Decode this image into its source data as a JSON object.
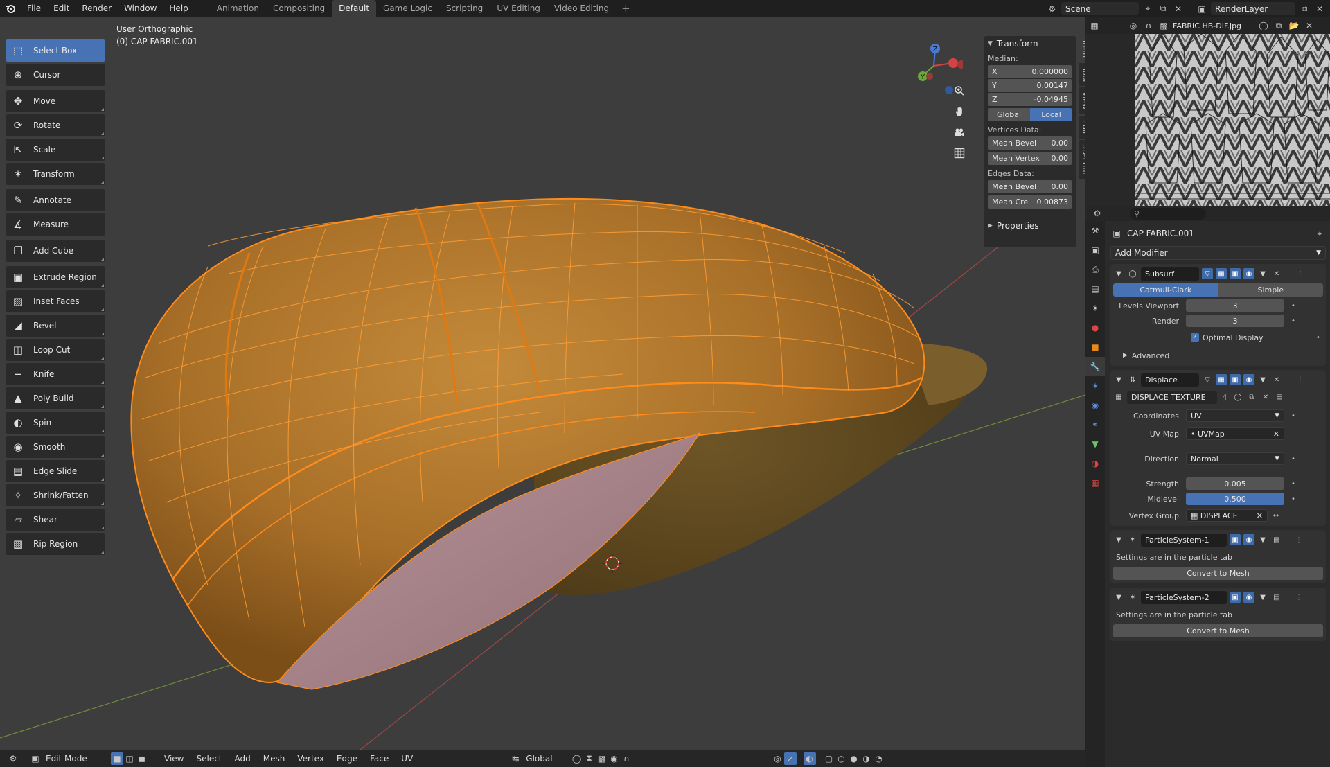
{
  "topbar": {
    "menus": [
      "File",
      "Edit",
      "Render",
      "Window",
      "Help"
    ],
    "workspaces": [
      "Animation",
      "Compositing",
      "Default",
      "Game Logic",
      "Scripting",
      "UV Editing",
      "Video Editing"
    ],
    "active_workspace": "Default",
    "plus": "+",
    "scene": "Scene",
    "render_layer": "RenderLayer"
  },
  "viewport": {
    "view_name": "User Orthographic",
    "object_name": "(0) CAP FABRIC.001"
  },
  "toolbar": {
    "tools": [
      {
        "label": "Select Box",
        "icon": "select-box-icon",
        "active": true
      },
      {
        "label": "Cursor",
        "icon": "cursor-icon"
      },
      {
        "label": "Move",
        "icon": "move-icon"
      },
      {
        "label": "Rotate",
        "icon": "rotate-icon"
      },
      {
        "label": "Scale",
        "icon": "scale-icon"
      },
      {
        "label": "Transform",
        "icon": "transform-icon"
      },
      {
        "label": "Annotate",
        "icon": "annotate-icon"
      },
      {
        "label": "Measure",
        "icon": "measure-icon"
      },
      {
        "label": "Add Cube",
        "icon": "add-cube-icon"
      },
      {
        "label": "Extrude Region",
        "icon": "extrude-icon"
      },
      {
        "label": "Inset Faces",
        "icon": "inset-icon"
      },
      {
        "label": "Bevel",
        "icon": "bevel-icon"
      },
      {
        "label": "Loop Cut",
        "icon": "loop-cut-icon"
      },
      {
        "label": "Knife",
        "icon": "knife-icon"
      },
      {
        "label": "Poly Build",
        "icon": "poly-build-icon"
      },
      {
        "label": "Spin",
        "icon": "spin-icon"
      },
      {
        "label": "Smooth",
        "icon": "smooth-icon"
      },
      {
        "label": "Edge Slide",
        "icon": "edge-slide-icon"
      },
      {
        "label": "Shrink/Fatten",
        "icon": "shrink-fatten-icon"
      },
      {
        "label": "Shear",
        "icon": "shear-icon"
      },
      {
        "label": "Rip Region",
        "icon": "rip-icon"
      }
    ]
  },
  "npanel": {
    "title": "Transform",
    "median_label": "Median:",
    "x_label": "X",
    "x": "0.000000",
    "y_label": "Y",
    "y": "0.00147",
    "z_label": "Z",
    "z": "-0.04945",
    "global": "Global",
    "local": "Local",
    "vertices_data": "Vertices Data:",
    "mean_bevel_label": "Mean Bevel",
    "mean_bevel_v": "0.00",
    "mean_vertex_label": "Mean Vertex",
    "mean_vertex_v": "0.00",
    "edges_data": "Edges Data:",
    "mean_bevel_e_label": "Mean Bevel",
    "mean_bevel_e": "0.00",
    "mean_crease_label": "Mean Cre",
    "mean_crease": "0.00873",
    "properties": "Properties",
    "tabs": [
      "Item",
      "Tool",
      "View",
      "Edit",
      "3D-Print"
    ]
  },
  "image_editor": {
    "image_name": "FABRIC HB-DIF.jpg"
  },
  "properties": {
    "object_name": "CAP FABRIC.001",
    "add_modifier": "Add Modifier",
    "subsurf": {
      "name": "Subsurf",
      "catmull": "Catmull-Clark",
      "simple": "Simple",
      "levels_label": "Levels Viewport",
      "levels": "3",
      "render_label": "Render",
      "render": "3",
      "optimal": "Optimal Display",
      "advanced": "Advanced"
    },
    "displace": {
      "name": "Displace",
      "texture": "DISPLACE TEXTURE",
      "texture_users": "4",
      "coords_label": "Coordinates",
      "coords": "UV",
      "uvmap_label": "UV Map",
      "uvmap": "UVMap",
      "direction_label": "Direction",
      "direction": "Normal",
      "strength_label": "Strength",
      "strength": "0.005",
      "midlevel_label": "Midlevel",
      "midlevel": "0.500",
      "vgroup_label": "Vertex Group",
      "vgroup": "DISPLACE"
    },
    "particles1": {
      "name": "ParticleSystem-1",
      "note": "Settings are in the particle tab",
      "button": "Convert to Mesh"
    },
    "particles2": {
      "name": "ParticleSystem-2",
      "note": "Settings are in the particle tab",
      "button": "Convert to Mesh"
    }
  },
  "bottombar": {
    "mode": "Edit Mode",
    "menus": [
      "View",
      "Select",
      "Add",
      "Mesh",
      "Vertex",
      "Edge",
      "Face",
      "UV"
    ],
    "orientation": "Global"
  },
  "colors": {
    "accent": "#4772b3",
    "wire": "#ff8c1a",
    "cap": "#b07a2e"
  }
}
